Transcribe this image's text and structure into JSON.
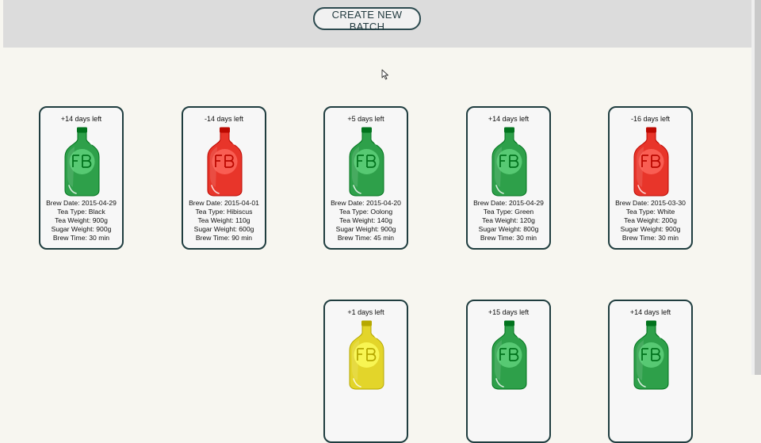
{
  "header": {
    "create_button_label": "CREATE NEW BATCH"
  },
  "colors": {
    "green": "#2ea04a",
    "red": "#e8352a",
    "yellow": "#e3d52a",
    "header_bg": "#dcdcdc",
    "border": "#1f3d3f"
  },
  "batches": [
    {
      "days_left": "+14 days left",
      "color": "green",
      "brew_date": "Brew Date: 2015-04-29",
      "tea_type": "Tea Type: Black",
      "tea_weight": "Tea Weight: 900g",
      "sugar_weight": "Sugar Weight: 900g",
      "brew_time": "Brew Time: 30 min"
    },
    {
      "days_left": "-14 days left",
      "color": "red",
      "brew_date": "Brew Date: 2015-04-01",
      "tea_type": "Tea Type: Hibiscus",
      "tea_weight": "Tea Weight: 110g",
      "sugar_weight": "Sugar Weight: 600g",
      "brew_time": "Brew Time: 90 min"
    },
    {
      "days_left": "+5 days left",
      "color": "green",
      "brew_date": "Brew Date: 2015-04-20",
      "tea_type": "Tea Type: Oolong",
      "tea_weight": "Tea Weight: 140g",
      "sugar_weight": "Sugar Weight: 900g",
      "brew_time": "Brew Time: 45 min"
    },
    {
      "days_left": "+14 days left",
      "color": "green",
      "brew_date": "Brew Date: 2015-04-29",
      "tea_type": "Tea Type: Green",
      "tea_weight": "Tea Weight: 120g",
      "sugar_weight": "Sugar Weight: 800g",
      "brew_time": "Brew Time: 30 min"
    },
    {
      "days_left": "-16 days left",
      "color": "red",
      "brew_date": "Brew Date: 2015-03-30",
      "tea_type": "Tea Type: White",
      "tea_weight": "Tea Weight: 200g",
      "sugar_weight": "Sugar Weight: 900g",
      "brew_time": "Brew Time: 30 min"
    },
    {
      "days_left": "+1 days left",
      "color": "yellow"
    },
    {
      "days_left": "+15 days left",
      "color": "green"
    },
    {
      "days_left": "+14 days left",
      "color": "green"
    }
  ]
}
